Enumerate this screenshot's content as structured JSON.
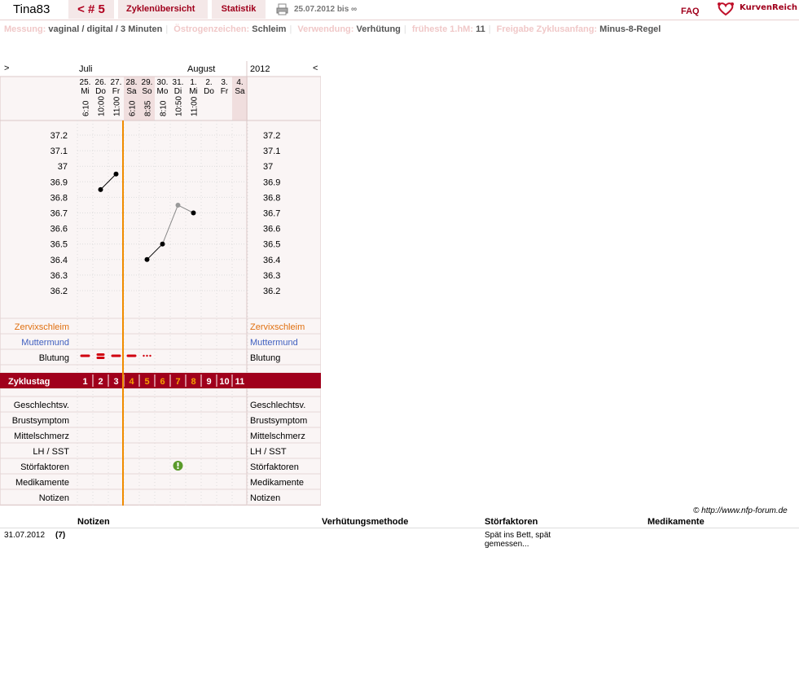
{
  "header": {
    "user": "Tina83",
    "cycle": "< # 5",
    "tabs": [
      "Zyklenübersicht",
      "Statistik"
    ],
    "date_range": "25.07.2012 bis ∞",
    "faq": "FAQ",
    "logo": "KurvenReich"
  },
  "info": [
    {
      "label": "Messung:",
      "value": "vaginal / digital / 3 Minuten"
    },
    {
      "label": "Östrogenzeichen:",
      "value": "Schleim"
    },
    {
      "label": "Verwendung:",
      "value": "Verhütung"
    },
    {
      "label": "früheste 1.hM:",
      "value": "11"
    },
    {
      "label": "Freigabe Zyklusanfang:",
      "value": "Minus-8-Regel"
    }
  ],
  "chart": {
    "nav_prev": ">",
    "nav_next": "<",
    "year": "2012",
    "months": [
      {
        "name": "Juli",
        "day": 0
      },
      {
        "name": "August",
        "day": 7
      }
    ],
    "days": [
      {
        "d": "25.",
        "w": "Mi",
        "t": "6:10",
        "weekend": false
      },
      {
        "d": "26.",
        "w": "Do",
        "t": "10:00",
        "weekend": false
      },
      {
        "d": "27.",
        "w": "Fr",
        "t": "11:00",
        "weekend": false
      },
      {
        "d": "28.",
        "w": "Sa",
        "t": "6:10",
        "weekend": true
      },
      {
        "d": "29.",
        "w": "So",
        "t": "8:35",
        "weekend": true
      },
      {
        "d": "30.",
        "w": "Mo",
        "t": "8:10",
        "weekend": false
      },
      {
        "d": "31.",
        "w": "Di",
        "t": "10:50",
        "weekend": false
      },
      {
        "d": "1.",
        "w": "Mi",
        "t": "11:00",
        "weekend": false
      },
      {
        "d": "2.",
        "w": "Do",
        "t": "",
        "weekend": false
      },
      {
        "d": "3.",
        "w": "Fr",
        "t": "",
        "weekend": false
      },
      {
        "d": "4.",
        "w": "Sa",
        "t": "",
        "weekend": true
      }
    ],
    "y_ticks": [
      "37.2",
      "37.1",
      "37",
      "36.9",
      "36.8",
      "36.7",
      "36.6",
      "36.5",
      "36.4",
      "36.3",
      "36.2"
    ],
    "ylim": [
      36.2,
      37.2
    ],
    "temps": [
      null,
      36.85,
      36.95,
      null,
      36.4,
      36.5,
      36.75,
      36.7,
      null,
      null,
      null
    ],
    "excluded": [
      false,
      false,
      false,
      false,
      false,
      false,
      true,
      false,
      false,
      false,
      false
    ],
    "segments": [
      [
        1,
        2
      ],
      [
        4,
        5
      ],
      [
        5,
        6
      ],
      [
        6,
        7
      ]
    ],
    "cover_after_day": 2,
    "rows_top": [
      {
        "label": "Zervixschleim",
        "color": "#e07010"
      },
      {
        "label": "Muttermund",
        "color": "#4060c0"
      },
      {
        "label": "Blutung",
        "color": "#000000"
      }
    ],
    "bleeding": [
      "heavy",
      "very-heavy",
      "heavy",
      "heavy",
      "spotting",
      "",
      "",
      "",
      "",
      "",
      ""
    ],
    "cycle_label": "Zyklustag",
    "cycle_days": [
      "1",
      "2",
      "3",
      "4",
      "5",
      "6",
      "7",
      "8",
      "9",
      "10",
      "11"
    ],
    "cycle_highlight": [
      false,
      false,
      false,
      true,
      true,
      true,
      true,
      true,
      false,
      false,
      false
    ],
    "rows_bottom": [
      "Geschlechtsv.",
      "Brustsymptom",
      "Mittelschmerz",
      "LH / SST",
      "Störfaktoren",
      "Medikamente",
      "Notizen"
    ],
    "disturb_day": 6
  },
  "footer": {
    "copyright": "© http://www.nfp-forum.de",
    "headers": [
      "Notizen",
      "Verhütungsmethode",
      "Störfaktoren",
      "Medikamente"
    ],
    "rows": [
      {
        "date": "31.07.2012",
        "day": "(7)",
        "stoer": "Spät ins Bett, spät gemessen..."
      }
    ]
  },
  "colors": {
    "accent": "#a0001c",
    "orange": "#f08c00",
    "grid": "#dddddd"
  }
}
